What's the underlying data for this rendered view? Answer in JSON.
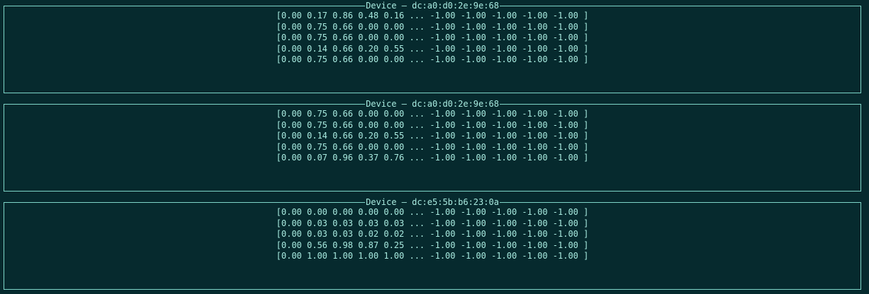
{
  "panels": [
    {
      "title": "Device – dc:a0:d0:2e:9e:68",
      "rows": [
        "[0.00 0.17 0.86 0.48 0.16 ... -1.00 -1.00 -1.00 -1.00 -1.00 ]",
        "[0.00 0.75 0.66 0.00 0.00 ... -1.00 -1.00 -1.00 -1.00 -1.00 ]",
        "[0.00 0.75 0.66 0.00 0.00 ... -1.00 -1.00 -1.00 -1.00 -1.00 ]",
        "[0.00 0.14 0.66 0.20 0.55 ... -1.00 -1.00 -1.00 -1.00 -1.00 ]",
        "[0.00 0.75 0.66 0.00 0.00 ... -1.00 -1.00 -1.00 -1.00 -1.00 ]"
      ]
    },
    {
      "title": "Device – dc:a0:d0:2e:9e:68",
      "rows": [
        "[0.00 0.75 0.66 0.00 0.00 ... -1.00 -1.00 -1.00 -1.00 -1.00 ]",
        "[0.00 0.75 0.66 0.00 0.00 ... -1.00 -1.00 -1.00 -1.00 -1.00 ]",
        "[0.00 0.14 0.66 0.20 0.55 ... -1.00 -1.00 -1.00 -1.00 -1.00 ]",
        "[0.00 0.75 0.66 0.00 0.00 ... -1.00 -1.00 -1.00 -1.00 -1.00 ]",
        "[0.00 0.07 0.96 0.37 0.76 ... -1.00 -1.00 -1.00 -1.00 -1.00 ]"
      ]
    },
    {
      "title": "Device – dc:e5:5b:b6:23:0a",
      "rows": [
        "[0.00 0.00 0.00 0.00 0.00 ... -1.00 -1.00 -1.00 -1.00 -1.00 ]",
        "[0.00 0.03 0.03 0.03 0.03 ... -1.00 -1.00 -1.00 -1.00 -1.00 ]",
        "[0.00 0.03 0.03 0.02 0.02 ... -1.00 -1.00 -1.00 -1.00 -1.00 ]",
        "[0.00 0.56 0.98 0.87 0.25 ... -1.00 -1.00 -1.00 -1.00 -1.00 ]",
        "[0.00 1.00 1.00 1.00 1.00 ... -1.00 -1.00 -1.00 -1.00 -1.00 ]"
      ]
    }
  ]
}
